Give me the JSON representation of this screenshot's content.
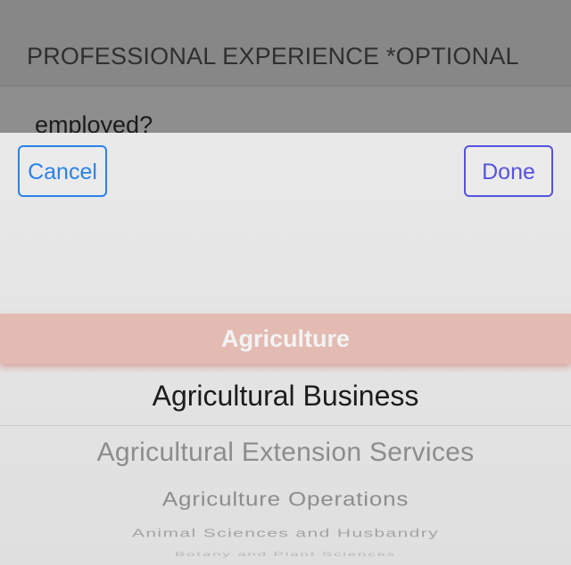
{
  "form": {
    "section_title": "PROFESSIONAL EXPERIENCE *OPTIONAL",
    "question_partial": "employed?"
  },
  "picker_sheet": {
    "cancel_label": "Cancel",
    "done_label": "Done",
    "highlighted_item": "Agriculture",
    "selected_item": "Agricultural Business",
    "items_below": [
      "Agricultural Extension Services",
      "Agriculture Operations",
      "Animal Sciences and Husbandry",
      "Botany and Plant Sciences"
    ],
    "colors": {
      "cancel_accent": "#2b82e9",
      "done_accent": "#5553df",
      "highlight": "#e3bbb2"
    }
  }
}
